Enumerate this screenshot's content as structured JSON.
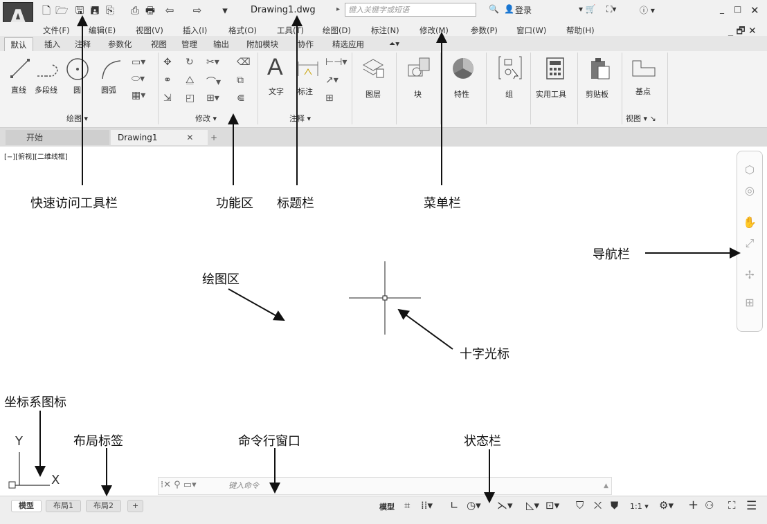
{
  "titlebar": {
    "file_title": "Drawing1.dwg",
    "search_placeholder": "键入关键字或短语",
    "login": "登录",
    "window_min": "_",
    "window_max": "□",
    "window_close": "✕"
  },
  "menubar": {
    "items": [
      "文件(F)",
      "编辑(E)",
      "视图(V)",
      "插入(I)",
      "格式(O)",
      "工具(T)",
      "绘图(D)",
      "标注(N)",
      "修改(M)",
      "参数(P)",
      "窗口(W)",
      "帮助(H)"
    ]
  },
  "ribbon_tabs": [
    "默认",
    "插入",
    "注释",
    "参数化",
    "视图",
    "管理",
    "输出",
    "附加模块",
    "协作",
    "精选应用"
  ],
  "ribbon": {
    "draw_tools": [
      "直线",
      "多段线",
      "圆",
      "圆弧"
    ],
    "draw_panel": "绘图 ▾",
    "modify_panel": "修改 ▾",
    "annotate_tools": [
      "文字",
      "标注"
    ],
    "annotate_panel": "注释 ▾",
    "big_tools": [
      "图层",
      "块",
      "特性",
      "组",
      "实用工具",
      "剪贴板"
    ],
    "base_tool": "基点",
    "view_panel": "视图 ▾ ↘"
  },
  "doc_tabs": {
    "start": "开始",
    "drawing": "Drawing1",
    "close": "✕",
    "plus": "+"
  },
  "viewport_label": "[−][俯视][二维线框]",
  "callouts": {
    "qat": "快速访问工具栏",
    "ribbon": "功能区",
    "title": "标题栏",
    "menu": "菜单栏",
    "navbar": "导航栏",
    "drawing_area": "绘图区",
    "crosshair": "十字光标",
    "ucs": "坐标系图标",
    "layout_tabs": "布局标签",
    "command": "命令行窗口",
    "status": "状态栏"
  },
  "ucs": {
    "y": "Y",
    "x": "X"
  },
  "command": {
    "placeholder": "键入命令"
  },
  "layout_tabs": [
    "模型",
    "布局1",
    "布局2",
    "+"
  ],
  "status": {
    "model": "模型",
    "scale": "1:1 ▾"
  }
}
